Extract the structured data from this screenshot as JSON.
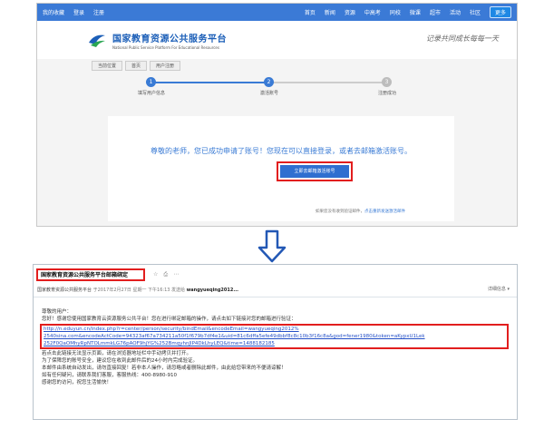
{
  "top": {
    "nav_left": [
      "我的收藏",
      "登录",
      "注册"
    ],
    "nav_right": [
      "首页",
      "新闻",
      "资源",
      "中高考",
      "同校",
      "微课",
      "超市",
      "活动",
      "社区"
    ],
    "nav_more": "更多",
    "logo_title": "国家教育资源公共服务平台",
    "logo_sub": "National Public Service Platform For Educational Resources",
    "slogan": "记录共同成长每每一天",
    "breadcrumb": [
      "当前位置",
      "首页",
      "用户注册"
    ],
    "steps": [
      {
        "num": "1",
        "label": "填写用户信息"
      },
      {
        "num": "2",
        "label": "激活账号"
      },
      {
        "num": "3",
        "label": "注册成功"
      }
    ],
    "welcome": "尊敬的老师，您已成功申请了账号！您现在可以直接登录，或者去邮箱激活账号。",
    "activate_button": "立即去邮箱激活账号",
    "no_email_text": "如果您没有收到验证邮件，",
    "no_email_link": "点击重新发送激活邮件"
  },
  "mail": {
    "subject": "国家教育资源公共服务平台邮箱绑定",
    "icons": [
      "star-icon",
      "print-icon",
      "more-icon"
    ],
    "sender": "国家教育资源公共服务平台",
    "time": "于2017年2月27日 星期一 下午16:13 发送给",
    "recipient": "wangyueqing2012...",
    "detail_label": "详细信息 ▾",
    "greeting": "尊敬的用户：",
    "intro": "您好！感谢您使用国家教育云资源服务公共平台！您在进行绑定邮箱的操作，请点击如下链接对您的邮箱进行验证：",
    "link_lines": [
      "http://n.eduyun.cn/index.php?r=center/person/security/bindEmail&encodeEmail=wangyueqing2012%",
      "2540sina.com&encodeActCode=94323af67a734211a50f1f679b7df4e1&uid=81c6dffa5efe49dbbf8c8c10b3f16c8a&god=fener1980&token=aKypxU1Lek",
      "252F0QaOMhyRpNTOLmmkLG76pAOF9hjYG%252BmqyhnJlP4DkLhyLEQ&time=1488182185"
    ],
    "tips": [
      "若点击此链接无法显示页面，请在浏览器地址栏中手动拷贝并打开。",
      "为了保障您的账号安全，建议您在收到此邮件后的24小时内完成验证。",
      "本邮件由系统自动发出，请勿直接回复！若非本人操作，请忽略或者删除此邮件，由此给您带来的不便请谅解！",
      "如有任何疑问，请联系我们客服，客服热线：400-8980-910",
      "感谢您的访问，祝您生活愉快！"
    ]
  },
  "colors": {
    "nav_blue": "#3b7ad6",
    "highlight_red": "#e21e1e",
    "link_blue": "#2450c7"
  }
}
